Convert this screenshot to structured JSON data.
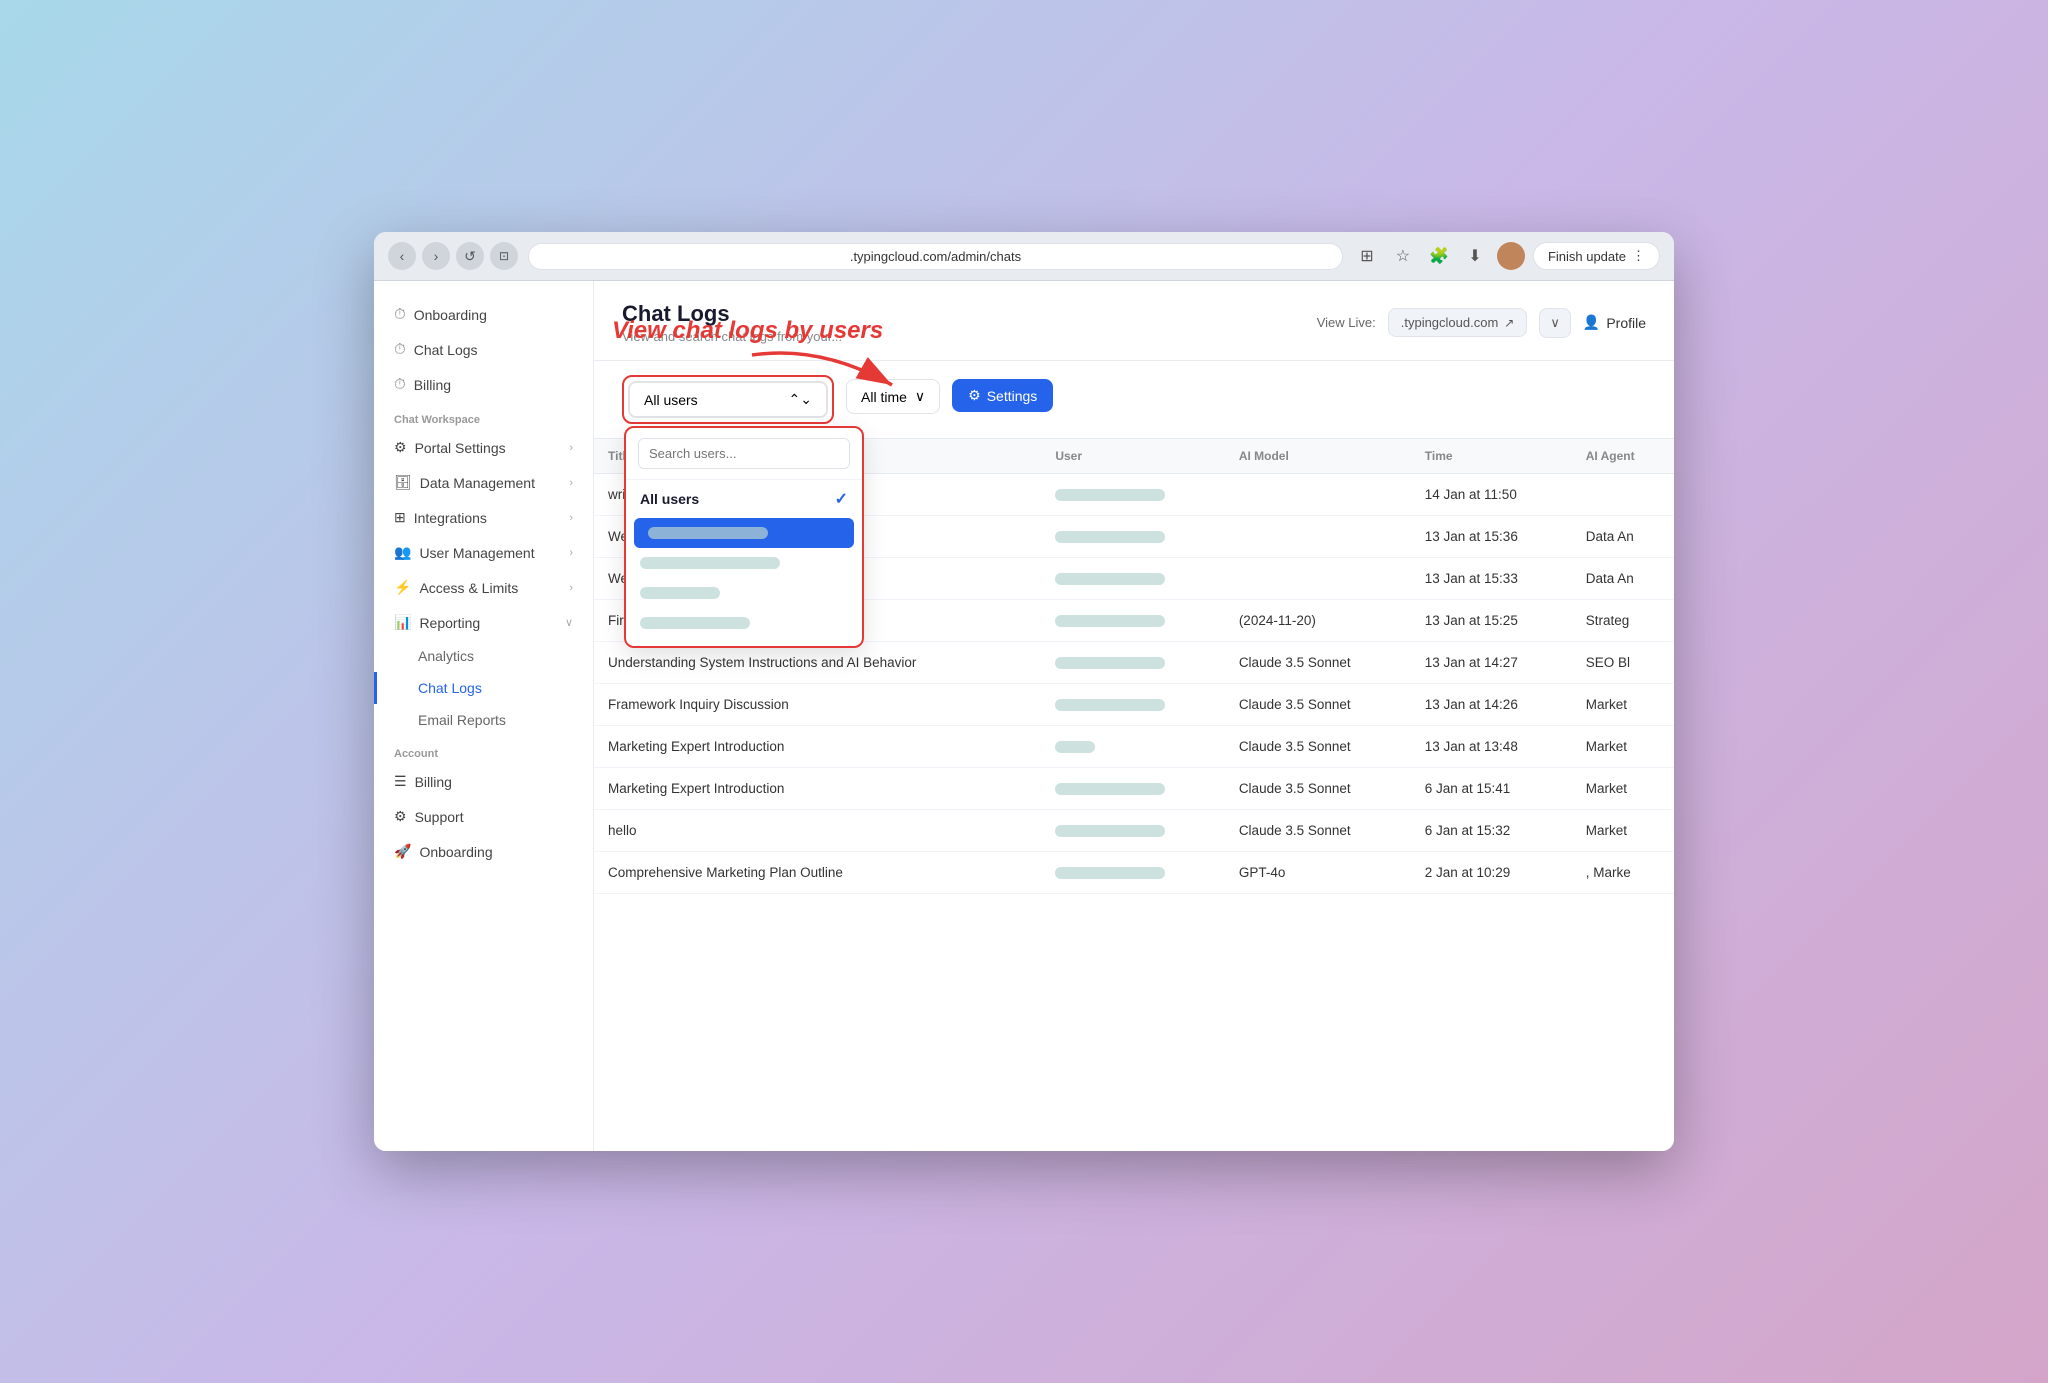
{
  "browser": {
    "url": ".typingcloud.com/admin/chats",
    "finish_update_label": "Finish update"
  },
  "header": {
    "title": "Chat Logs",
    "subtitle": "View and search chat logs from your...",
    "view_live_label": "View Live:",
    "view_live_url": ".typingcloud.com",
    "profile_label": "Profile"
  },
  "toolbar": {
    "users_select_label": "All users",
    "time_select_label": "All time",
    "settings_label": "Settings",
    "search_placeholder": "Search users...",
    "all_users_option": "All users"
  },
  "annotation": {
    "text": "View chat logs by users"
  },
  "table": {
    "columns": [
      "Title",
      "User",
      "AI Model",
      "Time",
      "AI Agent"
    ],
    "rows": [
      {
        "title": "write me",
        "user_bar": true,
        "model": "",
        "time": "14 Jan at 11:50",
        "agent": ""
      },
      {
        "title": "Website Analysis Request: Firecrawl.dev",
        "user_bar": true,
        "model": "",
        "time": "13 Jan at 15:36",
        "agent": "Data An"
      },
      {
        "title": "Website Analysis Inquiry: Firecrawl Dev",
        "user_bar": true,
        "model": "",
        "time": "13 Jan at 15:33",
        "agent": "Data An"
      },
      {
        "title": "Firecrawl Web Service Analysis",
        "user_bar": true,
        "model": "(2024-11-20)",
        "time": "13 Jan at 15:25",
        "agent": "Strateg"
      },
      {
        "title": "Understanding System Instructions and AI Behavior",
        "user_bar": true,
        "model": "Claude 3.5 Sonnet",
        "time": "13 Jan at 14:27",
        "agent": "SEO Bl"
      },
      {
        "title": "Framework Inquiry Discussion",
        "user_bar": true,
        "model": "Claude 3.5 Sonnet",
        "time": "13 Jan at 14:26",
        "agent": "Market"
      },
      {
        "title": "Marketing Expert Introduction",
        "user_bar": true,
        "model": "Claude 3.5 Sonnet",
        "time": "13 Jan at 13:48",
        "agent": "Market"
      },
      {
        "title": "Marketing Expert Introduction",
        "user_bar": true,
        "model": "Claude 3.5 Sonnet",
        "time": "6 Jan at 15:41",
        "agent": "Market"
      },
      {
        "title": "hello",
        "user_bar": true,
        "model": "Claude 3.5 Sonnet",
        "time": "6 Jan at 15:32",
        "agent": "Market"
      },
      {
        "title": "Comprehensive Marketing Plan Outline",
        "user_bar": true,
        "model": "GPT-4o",
        "time": "2 Jan at 10:29",
        "agent": ", Marke"
      }
    ]
  },
  "sidebar": {
    "top_items": [
      {
        "label": "Onboarding",
        "icon": "⏱"
      },
      {
        "label": "Chat Logs",
        "icon": "⏱"
      },
      {
        "label": "Billing",
        "icon": "⏱"
      }
    ],
    "workspace_label": "Chat Workspace",
    "workspace_items": [
      {
        "label": "Portal Settings",
        "icon": "⚙"
      },
      {
        "label": "Data Management",
        "icon": "🗄"
      },
      {
        "label": "Integrations",
        "icon": "⊞"
      },
      {
        "label": "User Management",
        "icon": "👥"
      },
      {
        "label": "Access & Limits",
        "icon": "⚡"
      }
    ],
    "reporting_label": "Reporting",
    "reporting_items": [
      {
        "label": "Analytics"
      },
      {
        "label": "Chat Logs",
        "active": true
      },
      {
        "label": "Email Reports"
      }
    ],
    "account_label": "Account",
    "account_items": [
      {
        "label": "Billing",
        "icon": "☰"
      },
      {
        "label": "Support",
        "icon": "⚙"
      },
      {
        "label": "Onboarding",
        "icon": "🚀"
      }
    ]
  }
}
